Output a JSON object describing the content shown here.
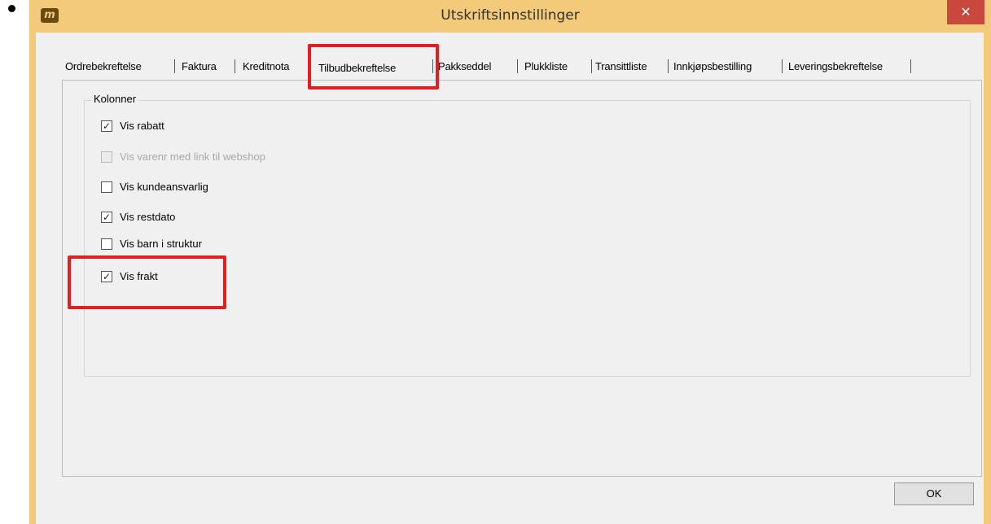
{
  "bullet": "•",
  "window": {
    "icon": "m",
    "title": "Utskriftsinnstillinger",
    "close_icon": "✕"
  },
  "tabs": [
    {
      "label": "Ordrebekreftelse",
      "active": false
    },
    {
      "label": "Faktura",
      "active": false
    },
    {
      "label": "Kreditnota",
      "active": false
    },
    {
      "label": "Tilbudbekreftelse",
      "active": true
    },
    {
      "label": "Pakkseddel",
      "active": false
    },
    {
      "label": "Plukkliste",
      "active": false
    },
    {
      "label": "Transittliste",
      "active": false
    },
    {
      "label": "Innkjøpsbestilling",
      "active": false
    },
    {
      "label": "Leveringsbekreftelse",
      "active": false
    }
  ],
  "group": {
    "label": "Kolonner",
    "items": [
      {
        "label": "Vis rabatt",
        "checked": true,
        "enabled": true
      },
      {
        "label": "Vis varenr med link til webshop",
        "checked": false,
        "enabled": false
      },
      {
        "label": "Vis kundeansvarlig",
        "checked": false,
        "enabled": true
      },
      {
        "label": "Vis restdato",
        "checked": true,
        "enabled": true
      },
      {
        "label": "Vis barn i struktur",
        "checked": false,
        "enabled": true
      },
      {
        "label": "Vis frakt",
        "checked": true,
        "enabled": true
      }
    ]
  },
  "ok_label": "OK",
  "colors": {
    "frame": "#f3c97a",
    "close": "#c9473d",
    "highlight": "#e02020"
  }
}
